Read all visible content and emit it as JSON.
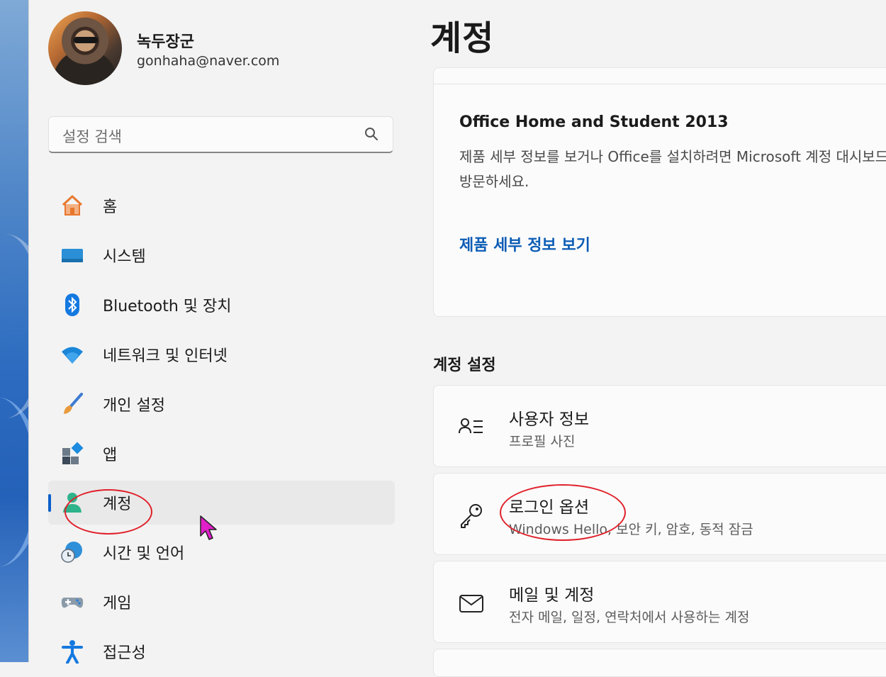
{
  "profile": {
    "name": "녹두장군",
    "email": "gonhaha@naver.com"
  },
  "search": {
    "placeholder": "설정 검색"
  },
  "sidebar": {
    "items": [
      {
        "label": "홈",
        "icon": "home-icon"
      },
      {
        "label": "시스템",
        "icon": "system-icon"
      },
      {
        "label": "Bluetooth 및 장치",
        "icon": "bluetooth-icon"
      },
      {
        "label": "네트워크 및 인터넷",
        "icon": "wifi-icon"
      },
      {
        "label": "개인 설정",
        "icon": "brush-icon"
      },
      {
        "label": "앱",
        "icon": "apps-icon"
      },
      {
        "label": "계정",
        "icon": "account-icon",
        "selected": true
      },
      {
        "label": "시간 및 언어",
        "icon": "time-language-icon"
      },
      {
        "label": "게임",
        "icon": "gamepad-icon"
      },
      {
        "label": "접근성",
        "icon": "accessibility-icon"
      }
    ]
  },
  "main": {
    "title": "계정",
    "office": {
      "title": "Office Home and Student 2013",
      "description": "제품 세부 정보를 보거나 Office를 설치하려면 Microsoft 계정 대시보드를 방문하세요.",
      "link": "제품 세부 정보 보기"
    },
    "section_header": "계정 설정",
    "settings": [
      {
        "title": "사용자 정보",
        "subtitle": "프로필 사진",
        "icon": "person-list-icon"
      },
      {
        "title": "로그인 옵션",
        "subtitle": "Windows Hello, 보안 키, 암호, 동적 잠금",
        "icon": "key-icon"
      },
      {
        "title": "메일 및 계정",
        "subtitle": "전자 메일, 일정, 연락처에서 사용하는 계정",
        "icon": "mail-icon"
      }
    ]
  },
  "colors": {
    "accent": "#0a5fc9",
    "annotation": "#e0202a",
    "cursor": "#e020c8"
  }
}
